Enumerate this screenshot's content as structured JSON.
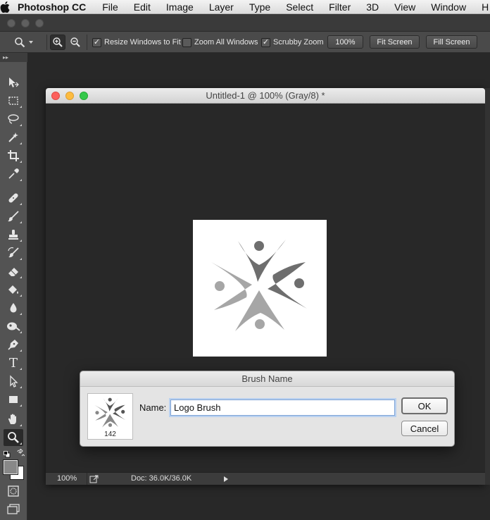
{
  "menubar": {
    "app_name": "Photoshop CC",
    "items": [
      "File",
      "Edit",
      "Image",
      "Layer",
      "Type",
      "Select",
      "Filter",
      "3D",
      "View",
      "Window",
      "H"
    ]
  },
  "options_bar": {
    "resize_windows_label": "Resize Windows to Fit",
    "resize_windows_checked": true,
    "zoom_all_label": "Zoom All Windows",
    "zoom_all_checked": false,
    "scrubby_zoom_label": "Scrubby Zoom",
    "scrubby_zoom_checked": true,
    "zoom_100_label": "100%",
    "fit_screen_label": "Fit Screen",
    "fill_screen_label": "Fill Screen"
  },
  "tools_panel": {
    "collapse_glyph": "▸▸",
    "tools": [
      {
        "name": "move-tool",
        "icon": "move-icon"
      },
      {
        "name": "marquee-tool",
        "icon": "marquee-icon"
      },
      {
        "name": "lasso-tool",
        "icon": "lasso-icon"
      },
      {
        "name": "magic-wand-tool",
        "icon": "magic-wand-icon"
      },
      {
        "name": "crop-tool",
        "icon": "crop-icon"
      },
      {
        "name": "eyedropper-tool",
        "icon": "eyedropper-icon"
      },
      {
        "name": "healing-brush-tool",
        "icon": "bandage-icon"
      },
      {
        "name": "brush-tool",
        "icon": "brush-icon"
      },
      {
        "name": "clone-stamp-tool",
        "icon": "stamp-icon"
      },
      {
        "name": "history-brush-tool",
        "icon": "history-brush-icon"
      },
      {
        "name": "eraser-tool",
        "icon": "eraser-icon"
      },
      {
        "name": "paint-bucket-tool",
        "icon": "paint-bucket-icon"
      },
      {
        "name": "blur-tool",
        "icon": "blur-drop-icon"
      },
      {
        "name": "dodge-tool",
        "icon": "dodge-icon"
      },
      {
        "name": "pen-tool",
        "icon": "pen-icon"
      },
      {
        "name": "type-tool",
        "icon": "type-icon"
      },
      {
        "name": "path-selection-tool",
        "icon": "arrow-icon"
      },
      {
        "name": "rectangle-tool",
        "icon": "rectangle-icon"
      },
      {
        "name": "hand-tool",
        "icon": "hand-icon"
      },
      {
        "name": "zoom-tool",
        "icon": "magnifier-icon",
        "active": true
      }
    ],
    "type_glyph": "T"
  },
  "document": {
    "title": "Untitled-1 @ 100% (Gray/8) *",
    "zoom_level": "100%",
    "doc_size": "Doc: 36.0K/36.0K"
  },
  "dialog": {
    "title": "Brush Name",
    "name_label": "Name:",
    "name_value": "Logo Brush",
    "brush_size": "142",
    "ok_label": "OK",
    "cancel_label": "Cancel"
  },
  "colors": {
    "traffic_close": "#fc605c",
    "traffic_minimize": "#fdbc40",
    "traffic_zoom": "#34c84a",
    "logo_light": "#a6a6a6",
    "logo_dark": "#6e6e6e"
  }
}
